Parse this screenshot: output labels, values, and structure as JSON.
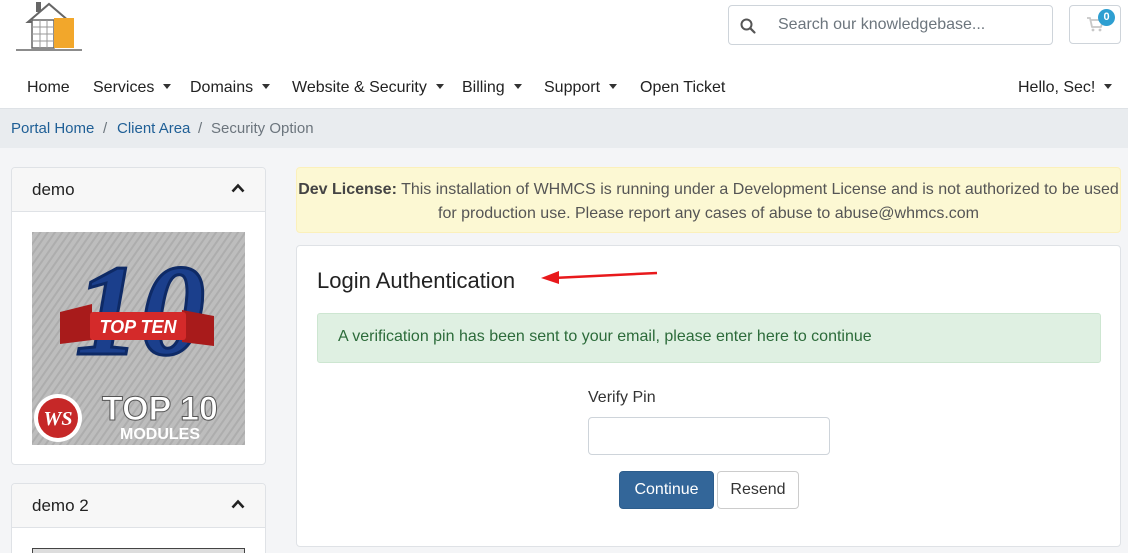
{
  "header": {
    "search_placeholder": "Search our knowledgebase...",
    "cart_count": "0"
  },
  "nav": {
    "items": [
      {
        "label": "Home"
      },
      {
        "label": "Services"
      },
      {
        "label": "Domains"
      },
      {
        "label": "Website & Security"
      },
      {
        "label": "Billing"
      },
      {
        "label": "Support"
      },
      {
        "label": "Open Ticket"
      }
    ],
    "user": "Hello, Sec!"
  },
  "breadcrumb": {
    "items": [
      "Portal Home",
      "Client Area",
      "Security Option"
    ],
    "separator": "/"
  },
  "sidebar": {
    "panels": [
      {
        "title": "demo"
      },
      {
        "title": "demo 2"
      }
    ],
    "promo": {
      "banner": "TOP TEN",
      "number": "10",
      "headline": "TOP 10",
      "subline": "MODULES",
      "badge": "WS"
    }
  },
  "notice": {
    "label": "Dev License:",
    "text": "This installation of WHMCS is running under a Development License and is not authorized to be used for production use. Please report any cases of abuse to abuse@whmcs.com"
  },
  "login": {
    "title": "Login Authentication",
    "message": "A verification pin has been sent to your email, please enter here to continue",
    "pin_label": "Verify Pin",
    "pin_value": "",
    "continue_label": "Continue",
    "resend_label": "Resend"
  },
  "colors": {
    "primary": "#336699",
    "link": "#1f5f96",
    "notice_bg": "#fcf8d3",
    "success_bg": "#dff0e2",
    "success_text": "#2c6b3a",
    "annotation_arrow": "#e8191c",
    "cart_badge": "#2e9fd1"
  },
  "icons": {
    "search": "search-icon",
    "cart": "cart-icon",
    "collapse": "chevron-up-icon",
    "dropdown": "caret-down-icon"
  }
}
